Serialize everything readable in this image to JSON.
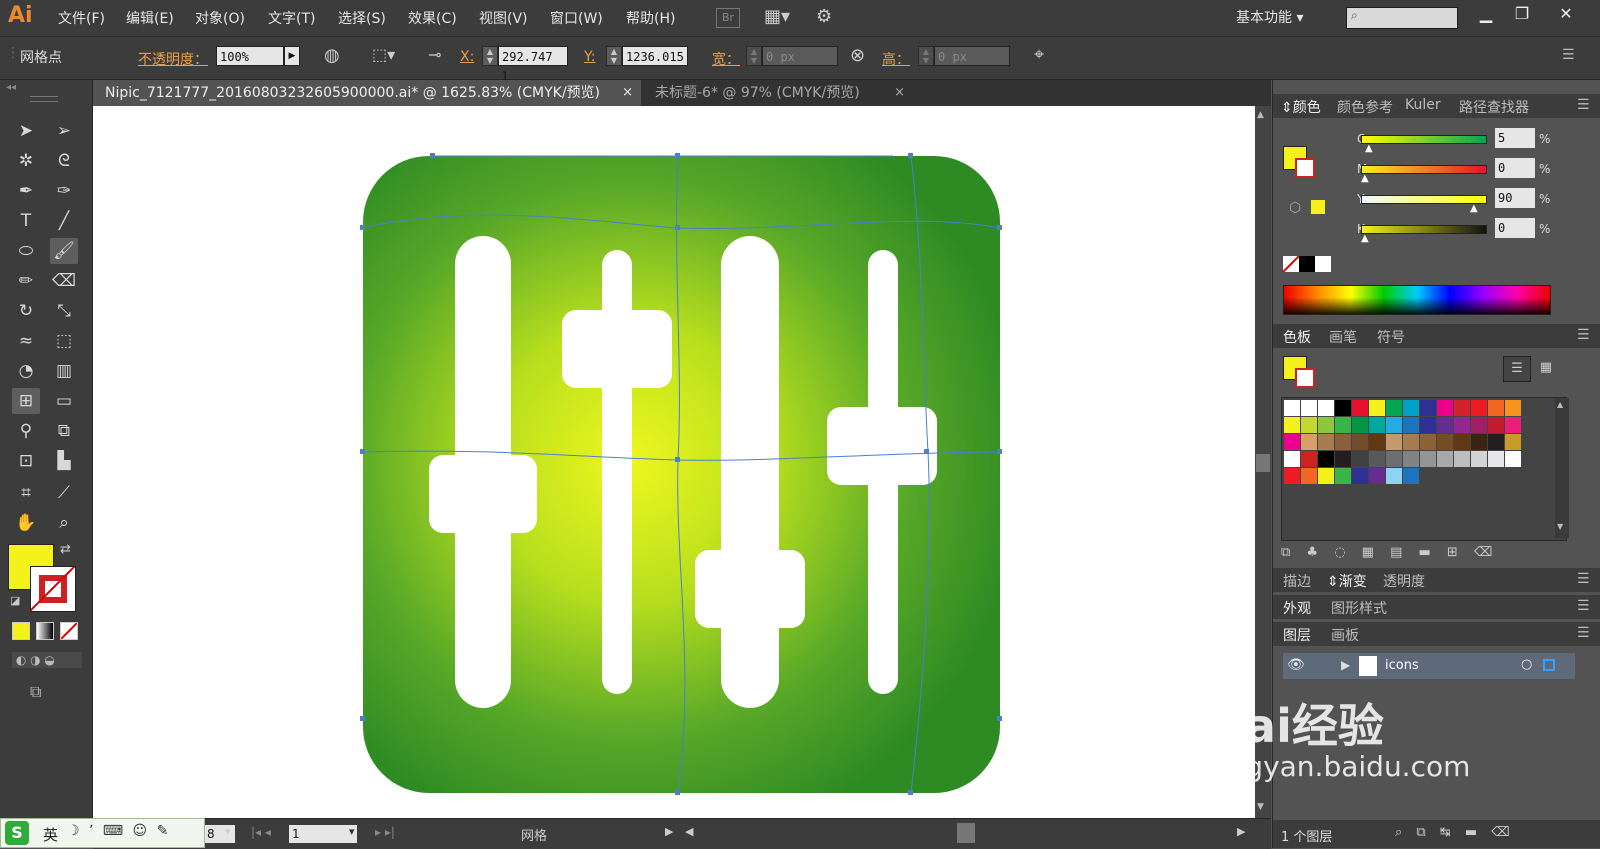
{
  "app": {
    "logo": "Ai"
  },
  "menu": [
    "文件(F)",
    "编辑(E)",
    "对象(O)",
    "文字(T)",
    "选择(S)",
    "效果(C)",
    "视图(V)",
    "窗口(W)",
    "帮助(H)"
  ],
  "bridge_label": "Br",
  "workspace": "基本功能",
  "control": {
    "object_type": "网格点",
    "opacity_label": "不透明度：",
    "opacity_value": "100%",
    "x_label": "X:",
    "x_value": "292.747 l",
    "y_label": "Y:",
    "y_value": "1236.015",
    "w_label": "宽：",
    "w_value": "0 px",
    "h_label": "高：",
    "h_value": "0 px"
  },
  "tabs": [
    {
      "label": "Nipic_7121777_20160803232605900000.ai* @ 1625.83% (CMYK/预览)",
      "active": true
    },
    {
      "label": "未标题-6* @ 97% (CMYK/预览)",
      "active": false
    }
  ],
  "status": {
    "zoom_field": "8",
    "page": "1",
    "tool": "网格"
  },
  "panels": {
    "color_tabs": [
      "颜色",
      "颜色参考",
      "Kuler",
      "路径查找器"
    ],
    "cmyk": [
      {
        "label": "C",
        "value": "5"
      },
      {
        "label": "M",
        "value": "0"
      },
      {
        "label": "Y",
        "value": "90"
      },
      {
        "label": "K",
        "value": "0"
      }
    ],
    "percent": "%",
    "swatch_tabs": [
      "色板",
      "画笔",
      "符号"
    ],
    "stroke_tabs": [
      "描边",
      "渐变",
      "透明度"
    ],
    "appearance_tabs": [
      "外观",
      "图形样式"
    ],
    "layer_tabs": [
      "图层",
      "画板"
    ],
    "layer_name": "icons",
    "layer_count": "1 个图层"
  },
  "colors": {
    "fill": "#f4f21a",
    "accent": "#e8a04a",
    "icon_dark": "#2e8a23",
    "icon_light": "#eef71e"
  },
  "ime": {
    "label": "英"
  },
  "watermark": {
    "brand": "Bai经验",
    "url": "jingyan.baidu.com"
  }
}
